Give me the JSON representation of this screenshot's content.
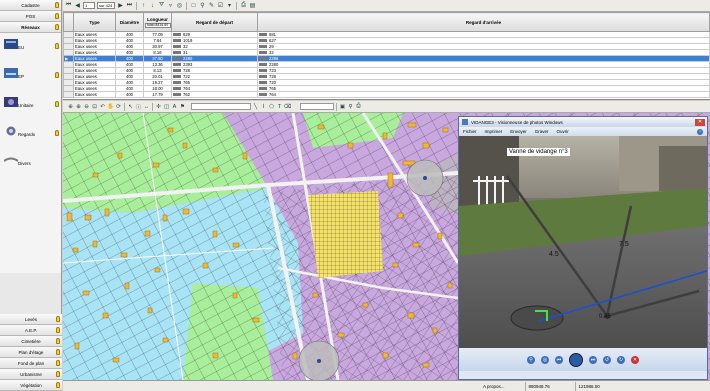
{
  "sidebar": {
    "top_items": [
      {
        "label": "Cadastre",
        "bold": false
      },
      {
        "label": "POS",
        "bold": false
      },
      {
        "label": "Réseaux",
        "bold": true
      }
    ],
    "layers": [
      {
        "label": "EU",
        "color": "#2c4a8a"
      },
      {
        "label": "EP",
        "color": "#3a6cb0"
      },
      {
        "label": "Unitaire",
        "color": "#3a3a7a"
      },
      {
        "label": "Regards",
        "color": "#6a6a9a"
      },
      {
        "label": "Divers",
        "color": "#7a7a7a"
      }
    ],
    "bottom_items": [
      {
        "label": "Levés"
      },
      {
        "label": "A.E.P."
      },
      {
        "label": "Cimetière"
      },
      {
        "label": "Plan d'étage"
      },
      {
        "label": "Fond de plan"
      },
      {
        "label": "Urbanisme"
      },
      {
        "label": "Végétation"
      }
    ]
  },
  "toolbar": {
    "record_field": "1",
    "total_field": "sur 424"
  },
  "grid": {
    "columns": [
      "Type",
      "Diamètre",
      "Longueur",
      "Regard de départ",
      "Regard d'arrivée"
    ],
    "length_filter": "total=8416.60",
    "rows": [
      [
        "Eaux usees",
        "400",
        "77.09",
        "629",
        "581"
      ],
      [
        "Eaux usees",
        "400",
        "7.64",
        "1019",
        "627"
      ],
      [
        "Eaux usees",
        "400",
        "30.97",
        "32",
        "29"
      ],
      [
        "Eaux usees",
        "400",
        "8.16",
        "31",
        "32"
      ],
      [
        "Eaux usees",
        "400",
        "37.50",
        "2280",
        "2296"
      ],
      [
        "Eaux usees",
        "400",
        "13.36",
        "2393",
        "2280"
      ],
      [
        "Eaux usees",
        "400",
        "8.13",
        "728",
        "723"
      ],
      [
        "Eaux usees",
        "400",
        "20.01",
        "722",
        "728"
      ],
      [
        "Eaux usees",
        "400",
        "19.27",
        "765",
        "720"
      ],
      [
        "Eaux usees",
        "400",
        "18.00",
        "764",
        "765"
      ],
      [
        "Eaux usees",
        "400",
        "17.79",
        "762",
        "764"
      ]
    ],
    "selected_index": 4
  },
  "viewer": {
    "title": "VIDANGE3 - Visionneuse de photos Windows",
    "menu": [
      "Fichier",
      "Imprimer",
      "Envoyer",
      "Graver",
      "Ouvrir"
    ],
    "caption": "Vanne de vidange n°3",
    "measure_1": "4.5",
    "measure_2": "7.5",
    "measure_3": "0.45"
  },
  "status": {
    "about": "A propos...",
    "x": "880948.76",
    "y": "121986.00"
  }
}
